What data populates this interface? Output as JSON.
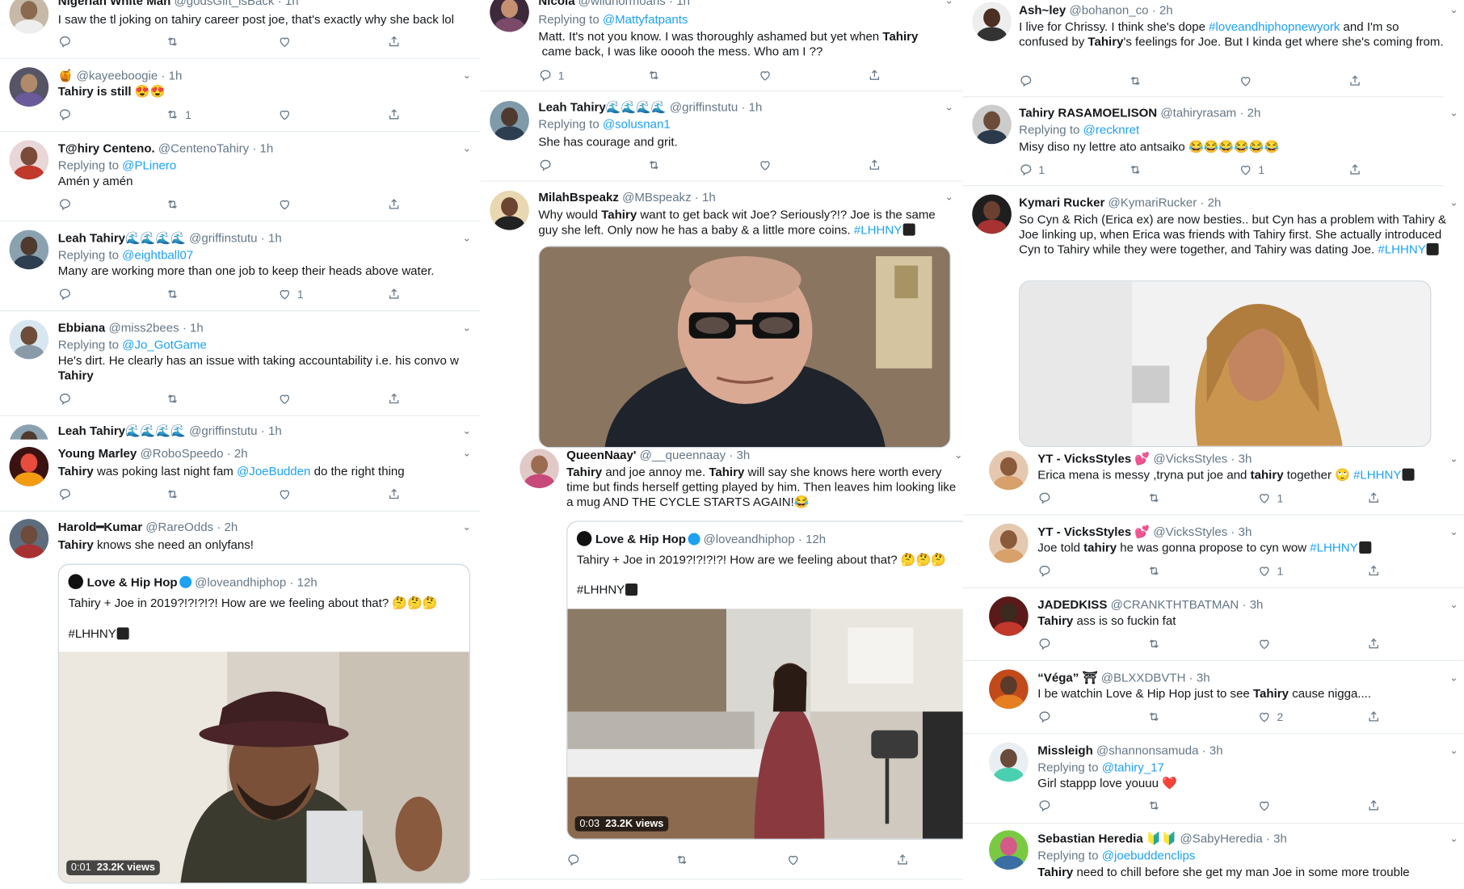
{
  "col1": {
    "t1": {
      "name": "Nigerian White Man",
      "handle": "@godsGift_isBack",
      "time": "1h",
      "text": "I saw the tl joking on tahiry career post joe, that's exactly why she back lol"
    },
    "t2": {
      "name": "🍯 ",
      "handle": "@kayeeboogie",
      "time": "1h",
      "text": "Tahiry is still 😍😍",
      "retweets": "1"
    },
    "t3": {
      "name": "T@hiry Centeno.",
      "handle": "@CentenoTahiry",
      "time": "1h",
      "replying": "Replying to",
      "reply_to": "@PLinero",
      "text": "Amén y amén"
    },
    "t4": {
      "name": "Leah Tahiry",
      "handle": "@griffinstutu",
      "time": "1h",
      "replying": "Replying to",
      "reply_to": "@eightball07",
      "text": "Many are working more than one job to keep their heads above water.",
      "likes": "1"
    },
    "t5": {
      "name": "Ebbiana",
      "handle": "@miss2bees",
      "time": "1h",
      "replying": "Replying to",
      "reply_to": "@Jo_GotGame",
      "text": "He's dirt. He clearly has an issue with taking accountability i.e. his convo w",
      "text2": "Tahiry"
    },
    "t6": {
      "name": "Leah Tahiry",
      "handle": "@griffinstutu",
      "time": "1h"
    },
    "t7": {
      "name": "Young Marley",
      "handle": "@RoboSpeedo",
      "time": "2h",
      "text_a": "Tahiry",
      "text_b": " was poking last night fam ",
      "mention": "@JoeBudden",
      "text_c": " do the right thing"
    },
    "t8": {
      "name": "Harold━Kumar",
      "handle": "@RareOdds",
      "time": "2h",
      "text_a": "Tahiry",
      "text_b": " knows she need an onlyfans!",
      "quote": {
        "name": "Love & Hip Hop",
        "handle": "@loveandhiphop",
        "time": "12h",
        "text": "Tahiry + Joe in 2019?!?!?!?! How are we feeling about that? 🤔🤔🤔",
        "tag": "#LHHNY",
        "video_time": "0:01",
        "views": "23.2K views"
      }
    }
  },
  "col2": {
    "t1": {
      "name": "Nicola",
      "handle": "@wildhormoans",
      "time": "1h",
      "replying": "Replying to",
      "reply_to": "@Mattyfatpants",
      "text": "Matt. It's not you know. I was thoroughly ashamed but yet when",
      "text_bold": "Tahiry",
      "text2": "came back, I was like ooooh the mess. Who am I ??",
      "replies": "1"
    },
    "t2": {
      "name": "Leah Tahiry",
      "handle": "@griffinstutu",
      "time": "1h",
      "replying": "Replying to",
      "reply_to": "@solusnan1",
      "text": "She has courage and grit."
    },
    "t3": {
      "name": "MilahBspeakz",
      "handle": "@MBspeakz",
      "time": "1h",
      "text_a": "Why would ",
      "text_bold": "Tahiry",
      "text_b": " want to get back wit Joe? Seriously?!? Joe is the same guy she left. Only now he has a baby & a little more coins. ",
      "tag": "#LHHNY"
    },
    "t4": {
      "name": "QueenNaay'",
      "handle": "@__queennaay",
      "time": "3h",
      "text_bold1": "Tahiry",
      "text_a": " and joe annoy me. ",
      "text_bold2": "Tahiry",
      "text_b": " will say she knows here worth every time but finds herself getting played by him. Then leaves him looking like a mug AND THE CYCLE STARTS AGAIN!😂",
      "quote": {
        "name": "Love & Hip Hop",
        "handle": "@loveandhiphop",
        "time": "12h",
        "text": "Tahiry + Joe in 2019?!?!?!?! How are we feeling about that? 🤔🤔🤔",
        "tag": "#LHHNY",
        "video_time": "0:03",
        "views": "23.2K views"
      }
    }
  },
  "col3": {
    "t1": {
      "name": "Ash~ley",
      "handle": "@bohanon_co",
      "time": "2h",
      "text_a": "I live for Chrissy. I think she's dope ",
      "tag": "#loveandhiphopnewyork",
      "text_b": " and I'm so confused by ",
      "text_bold": "Tahiry",
      "text_c": "'s feelings for Joe. But I kinda get where she's coming from."
    },
    "t2": {
      "name": "Tahiry RASAMOELISON",
      "handle": "@tahiryrasam",
      "time": "2h",
      "replying": "Replying to",
      "reply_to": "@recknret",
      "text": "Misy diso ny lettre ato antsaiko 😂😂😂😂😂😂",
      "replies": "1",
      "likes": "1"
    },
    "t3": {
      "name": "Kymari Rucker",
      "handle": "@KymariRucker",
      "time": "2h",
      "text": "So Cyn & Rich (Erica ex) are now besties.. but Cyn has a problem with Tahiry & Joe linking up, when Erica was friends with Tahiry first. She actually introduced Cyn to Tahiry while they were together, and Tahiry was dating Joe.",
      "tag": "#LHHNY"
    },
    "t4": {
      "name": "YT - VicksStyles 💕",
      "handle": "@VicksStyles",
      "time": "3h",
      "text_a": "Erica mena is messy ,tryna put joe and ",
      "text_bold": "tahiry",
      "text_b": " together 🙄 ",
      "tag": "#LHHNY",
      "likes": "1"
    },
    "t5": {
      "name": "YT - VicksStyles 💕",
      "handle": "@VicksStyles",
      "time": "3h",
      "text_a": "Joe told ",
      "text_bold": "tahiry",
      "text_b": " he was gonna propose to cyn wow ",
      "tag": "#LHHNY",
      "likes": "1"
    },
    "t6": {
      "name": "JADEDKISS",
      "handle": "@CRANKTHTBATMAN",
      "time": "3h",
      "text_bold": "Tahiry",
      "text_b": " ass is so fuckin fat"
    },
    "t7": {
      "name": "“Véga” ⛩",
      "handle": "@BLXXDBVTH",
      "time": "3h",
      "text_a": "I be watchin Love & Hip Hop just to see ",
      "text_bold": "Tahiry",
      "text_b": " cause nigga....",
      "likes": "2"
    },
    "t8": {
      "name": "Missleigh",
      "handle": "@shannonsamuda",
      "time": "3h",
      "replying": "Replying to",
      "reply_to": "@tahiry_17",
      "text": "Girl stappp love youuu ❤️"
    },
    "t9": {
      "name": "Sebastian Heredia 🔰🔰",
      "handle": "@SabyHeredia",
      "time": "3h",
      "replying": "Replying to",
      "reply_to": "@joebuddenclips",
      "text_bold": "Tahiry",
      "text_b": " need to chill before she get my man Joe in some more trouble"
    }
  },
  "colors": {
    "link": "#1da1f2",
    "muted": "#657786",
    "border": "#e6ecf0",
    "heart": "#e0245e"
  },
  "icons": [
    "reply-icon",
    "retweet-icon",
    "like-icon",
    "share-icon",
    "chevron-down-icon",
    "verified-icon"
  ]
}
